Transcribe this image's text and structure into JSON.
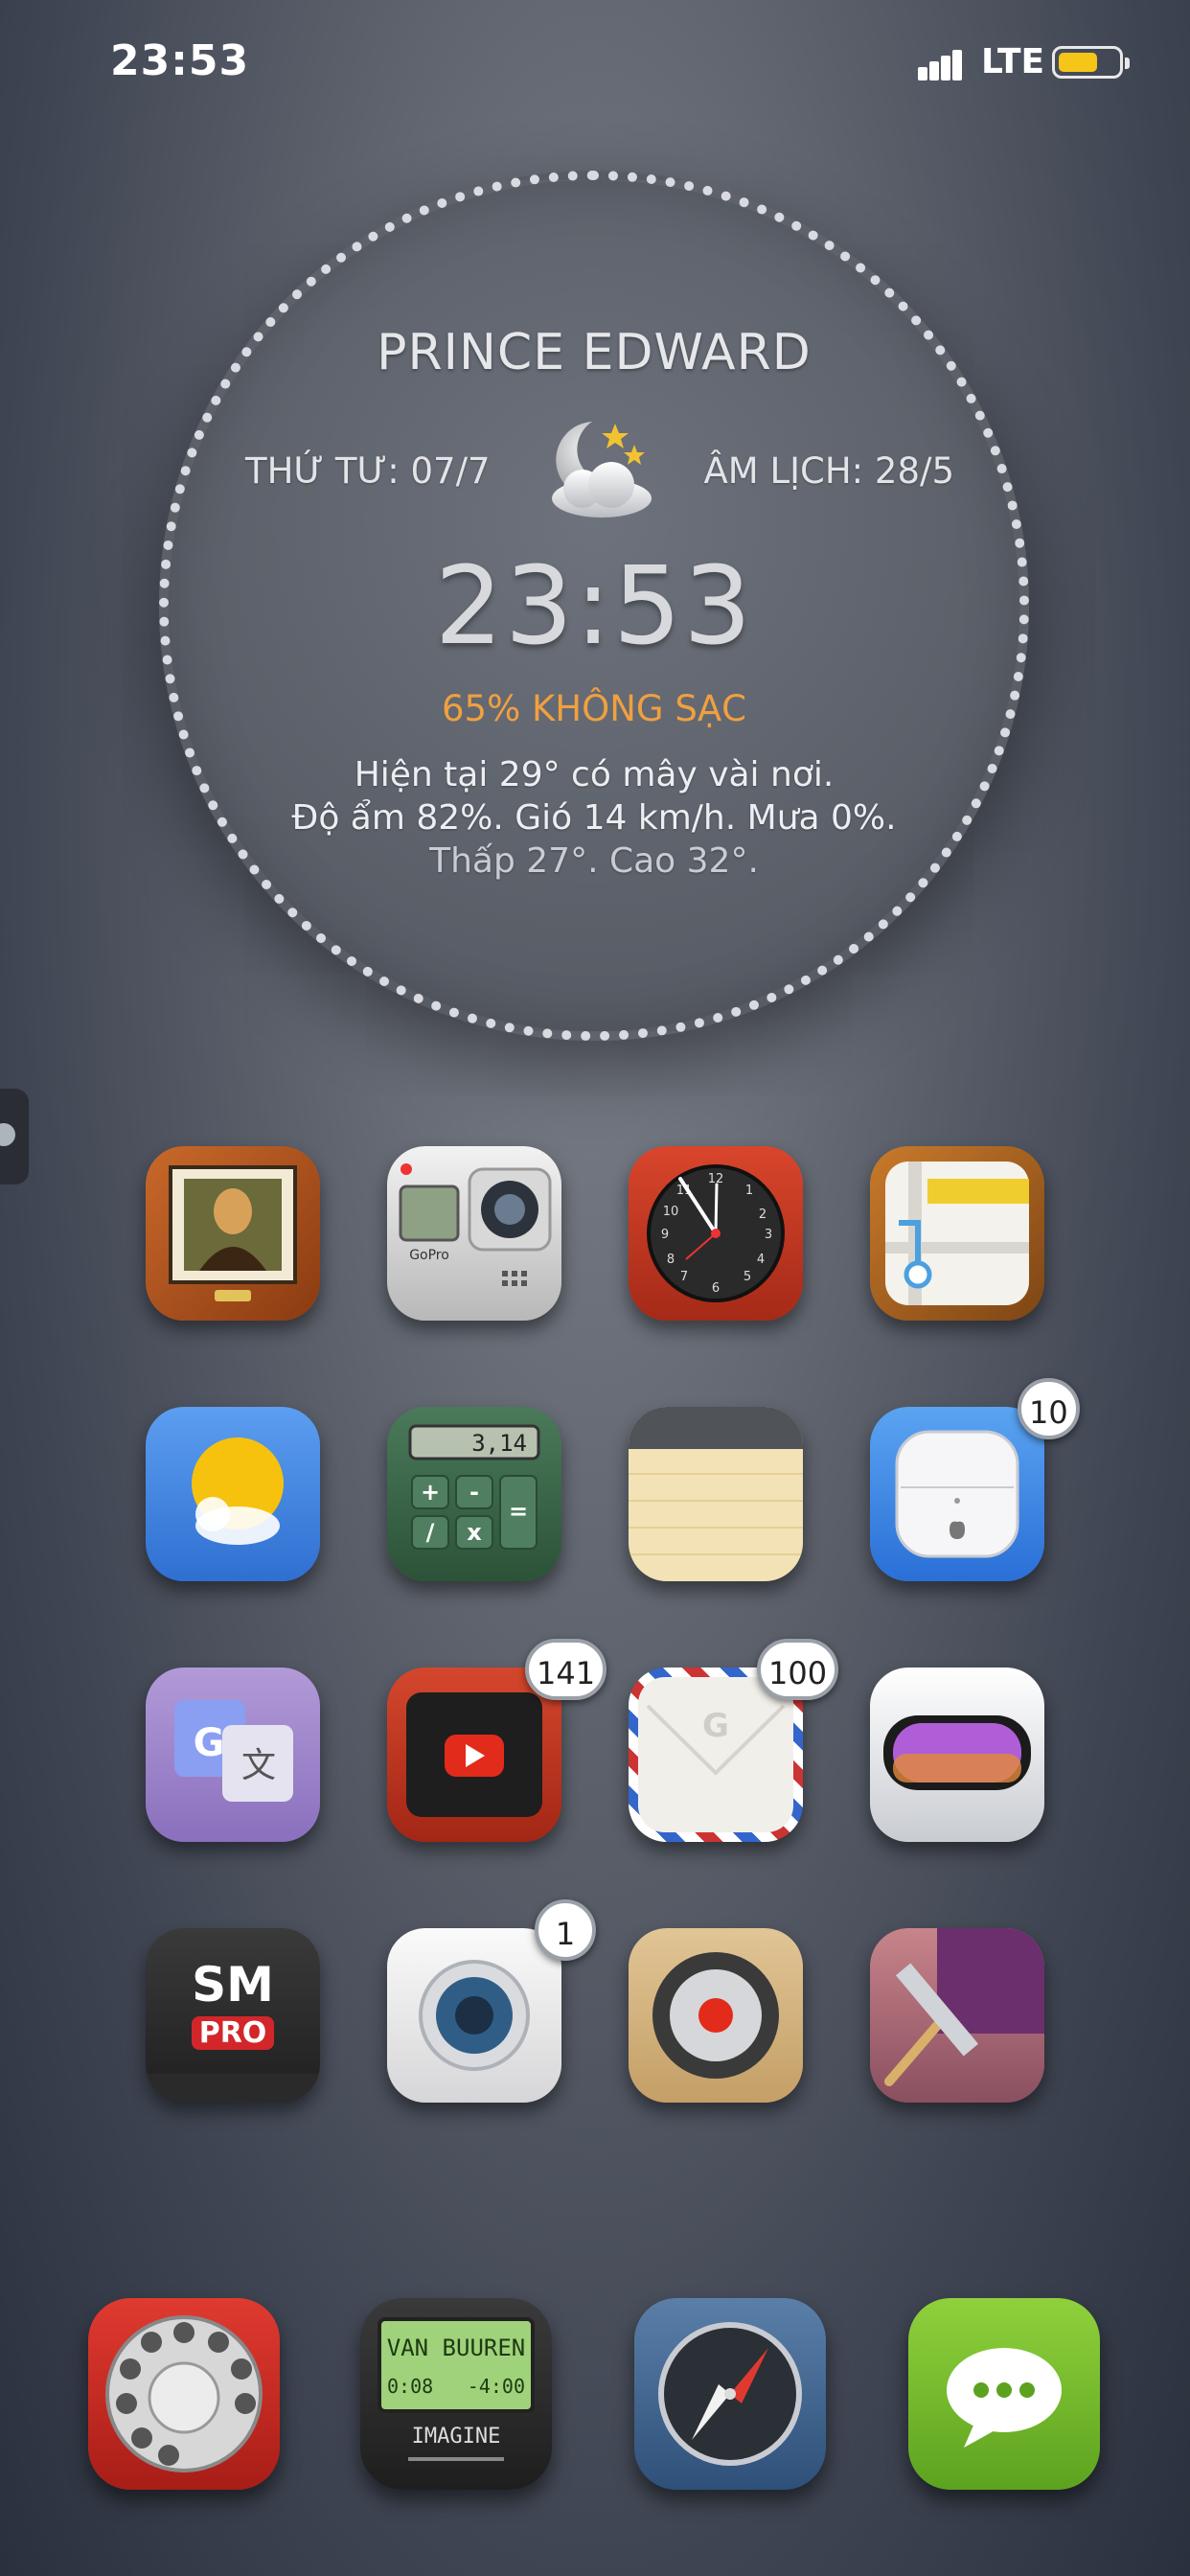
{
  "status_bar": {
    "time": "23:53",
    "network": "LTE",
    "battery_level": 0.65,
    "battery_color": "#f5c518"
  },
  "widget": {
    "city": "PRINCE EDWARD",
    "date": "THỨ TƯ: 07/7",
    "lunar": "ÂM LỊCH: 28/5",
    "weather_icon": "night-cloudy-icon",
    "time": "23:53",
    "battery_status": "65% KHÔNG SẠC",
    "battery_status_color": "#f0a040",
    "line1": "Hiện tại 29° có mây vài nơi.",
    "line2": "Độ ẩm 82%. Gió 14 km/h. Mưa 0%.",
    "line3": "Thấp 27°. Cao 32°."
  },
  "apps": [
    {
      "icon": "mona-lisa-gallery-icon",
      "badge": ""
    },
    {
      "icon": "gopro-camera-icon",
      "badge": ""
    },
    {
      "icon": "clock-icon",
      "badge": ""
    },
    {
      "icon": "maps-icon",
      "badge": ""
    },
    {
      "icon": "weather-sun-icon",
      "badge": ""
    },
    {
      "icon": "calculator-icon",
      "badge": ""
    },
    {
      "icon": "notes-icon",
      "badge": ""
    },
    {
      "icon": "airpods-icon",
      "badge": "10"
    },
    {
      "icon": "google-translate-icon",
      "badge": ""
    },
    {
      "icon": "youtube-icon",
      "badge": "141"
    },
    {
      "icon": "gmail-icon",
      "badge": "100"
    },
    {
      "icon": "ski-goggles-icon",
      "badge": ""
    },
    {
      "icon": "sm-pro-icon",
      "badge": ""
    },
    {
      "icon": "camera-icon",
      "badge": "1"
    },
    {
      "icon": "record-button-icon",
      "badge": ""
    },
    {
      "icon": "wallpaper-squeegee-icon",
      "badge": ""
    }
  ],
  "calculator_display": "3,14",
  "sm_pro": {
    "top": "SM",
    "bottom": "PRO"
  },
  "dock": {
    "phone_icon": "rotary-phone-icon",
    "music": {
      "icon": "music-player-icon",
      "artist": "VAN BUUREN",
      "elapsed": "0:08",
      "remaining": "-4:00",
      "title": "IMAGINE"
    },
    "safari_icon": "compass-icon",
    "messages_icon": "messages-icon"
  }
}
